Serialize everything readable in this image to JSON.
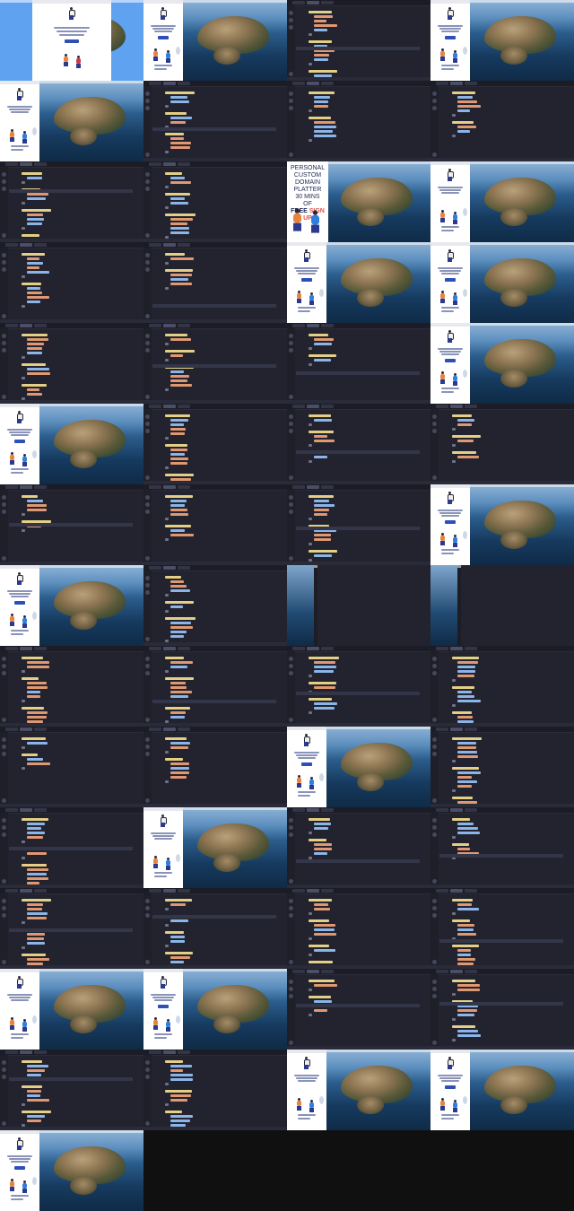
{
  "tiles": [
    {
      "kind": "desktop-left"
    },
    {
      "kind": "desktop-panel-left"
    },
    {
      "kind": "editor"
    },
    {
      "kind": "desktop-panel-left"
    },
    {
      "kind": "desktop-panel-left"
    },
    {
      "kind": "editor"
    },
    {
      "kind": "editor"
    },
    {
      "kind": "editor"
    },
    {
      "kind": "editor"
    },
    {
      "kind": "editor"
    },
    {
      "kind": "desktop-big-text"
    },
    {
      "kind": "desktop-panel-left"
    },
    {
      "kind": "editor"
    },
    {
      "kind": "editor"
    },
    {
      "kind": "desktop-panel-left"
    },
    {
      "kind": "desktop-panel-left"
    },
    {
      "kind": "editor"
    },
    {
      "kind": "editor"
    },
    {
      "kind": "editor"
    },
    {
      "kind": "desktop-panel-left"
    },
    {
      "kind": "desktop-panel-left"
    },
    {
      "kind": "editor"
    },
    {
      "kind": "editor"
    },
    {
      "kind": "editor"
    },
    {
      "kind": "editor"
    },
    {
      "kind": "editor"
    },
    {
      "kind": "editor"
    },
    {
      "kind": "desktop-panel-left"
    },
    {
      "kind": "desktop-panel-left"
    },
    {
      "kind": "editor"
    },
    {
      "kind": "desktop-split"
    },
    {
      "kind": "desktop-split"
    },
    {
      "kind": "editor"
    },
    {
      "kind": "editor"
    },
    {
      "kind": "editor"
    },
    {
      "kind": "editor"
    },
    {
      "kind": "editor"
    },
    {
      "kind": "editor"
    },
    {
      "kind": "desktop-panel-left"
    },
    {
      "kind": "editor"
    },
    {
      "kind": "editor"
    },
    {
      "kind": "desktop-panel-left"
    },
    {
      "kind": "editor"
    },
    {
      "kind": "editor"
    },
    {
      "kind": "editor"
    },
    {
      "kind": "editor"
    },
    {
      "kind": "editor"
    },
    {
      "kind": "editor"
    },
    {
      "kind": "desktop-panel-left"
    },
    {
      "kind": "desktop-panel-left"
    },
    {
      "kind": "editor"
    },
    {
      "kind": "editor"
    },
    {
      "kind": "editor"
    },
    {
      "kind": "editor"
    },
    {
      "kind": "desktop-panel-left"
    },
    {
      "kind": "desktop-panel-left"
    },
    {
      "kind": "desktop-panel-left"
    },
    {
      "kind": "empty"
    },
    {
      "kind": "empty"
    },
    {
      "kind": "empty"
    }
  ],
  "big_preview": {
    "line1": "PERSONAL",
    "line2": "CUSTOM DOMAIN",
    "line3": "PLATTER 30 MINS OF",
    "line4_a": "FREE",
    "line4_b": "SIGN UP"
  },
  "panel_free_label": "FREE"
}
